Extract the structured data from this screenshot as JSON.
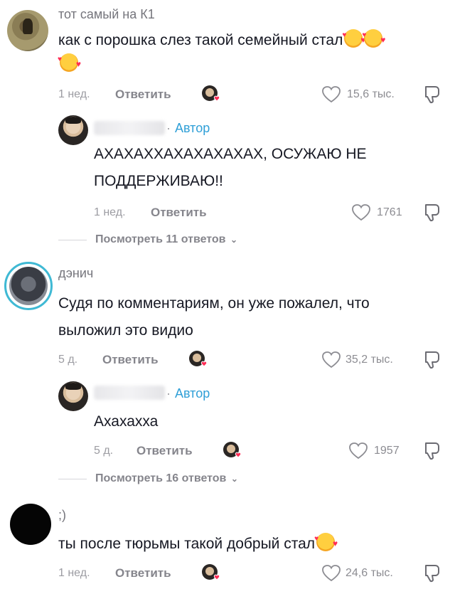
{
  "comments": [
    {
      "username": "тот самый на К1",
      "text_lines": [
        "как с порошка слез такой семейный стал"
      ],
      "emoji_count": 3,
      "age": "1 нед.",
      "reply_label": "Ответить",
      "likes": "15,6 тыс.",
      "author_reply": {
        "author_label": "Автор",
        "text_lines": [
          "АХАХАХХАХАХАХАХАХ, ОСУЖАЮ НЕ",
          "ПОДДЕРЖИВАЮ!!"
        ],
        "age": "1 нед.",
        "reply_label": "Ответить",
        "likes": "1761"
      },
      "view_replies": "Посмотреть 11 ответов"
    },
    {
      "username": "дэнич",
      "text_lines": [
        "Судя по комментариям, он уже пожалел, что",
        "выложил это видио"
      ],
      "age": "5 д.",
      "reply_label": "Ответить",
      "likes": "35,2 тыс.",
      "author_reply": {
        "author_label": "Автор",
        "text_lines": [
          "Ахахахха"
        ],
        "age": "5 д.",
        "reply_label": "Ответить",
        "likes": "1957"
      },
      "view_replies": "Посмотреть 16 ответов"
    },
    {
      "username": ";)",
      "text_lines": [
        "ты после тюрьмы такой добрый стал"
      ],
      "emoji_count": 1,
      "age": "1 нед.",
      "reply_label": "Ответить",
      "likes": "24,6 тыс."
    }
  ],
  "icons": {
    "like": "heart-outline-icon",
    "dislike": "thumbs-down-icon",
    "creator_liked": "creator-liked-avatar-icon",
    "expand": "chevron-down-icon"
  },
  "colors": {
    "author_label": "#2f9fd7",
    "secondary_text": "#85858c",
    "heart_badge": "#fe2c55",
    "story_ring": "#3fb9d4"
  }
}
